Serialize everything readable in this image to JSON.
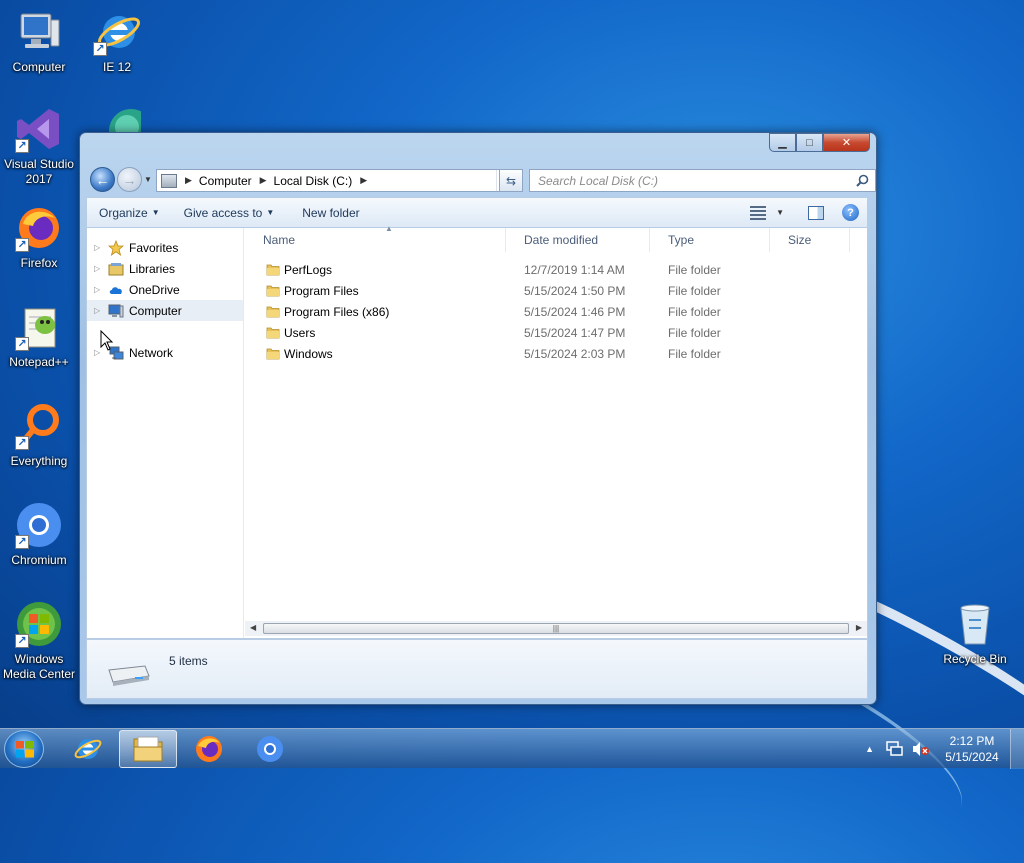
{
  "desktop": {
    "icons": [
      {
        "label": "Computer"
      },
      {
        "label": "IE 12"
      },
      {
        "label": "Visual Studio 2017"
      },
      {
        "label": "Firefox"
      },
      {
        "label": "Notepad++"
      },
      {
        "label": "Everything"
      },
      {
        "label": "Chromium"
      },
      {
        "label": "Windows Media Center"
      },
      {
        "label": "Recycle Bin"
      }
    ]
  },
  "window": {
    "address": {
      "crumbs": [
        "Computer",
        "Local Disk (C:)"
      ]
    },
    "search": {
      "placeholder": "Search Local Disk (C:)"
    },
    "toolbar": {
      "organize": "Organize",
      "give_access": "Give access to",
      "new_folder": "New folder"
    },
    "nav": [
      {
        "label": "Favorites",
        "icon": "star-icon"
      },
      {
        "label": "Libraries",
        "icon": "libraries-icon"
      },
      {
        "label": "OneDrive",
        "icon": "cloud-icon"
      },
      {
        "label": "Computer",
        "icon": "computer-icon"
      },
      {
        "label": "Network",
        "icon": "network-icon"
      }
    ],
    "columns": {
      "name": "Name",
      "date": "Date modified",
      "type": "Type",
      "size": "Size"
    },
    "files": [
      {
        "name": "PerfLogs",
        "date": "12/7/2019 1:14 AM",
        "type": "File folder"
      },
      {
        "name": "Program Files",
        "date": "5/15/2024 1:50 PM",
        "type": "File folder"
      },
      {
        "name": "Program Files (x86)",
        "date": "5/15/2024 1:46 PM",
        "type": "File folder"
      },
      {
        "name": "Users",
        "date": "5/15/2024 1:47 PM",
        "type": "File folder"
      },
      {
        "name": "Windows",
        "date": "5/15/2024 2:03 PM",
        "type": "File folder"
      }
    ],
    "status": {
      "item_count": "5 items"
    }
  },
  "taskbar": {
    "clock_time": "2:12 PM",
    "clock_date": "5/15/2024"
  },
  "colors": {
    "desktop_blue": "#1267c8",
    "window_frame": "#a9c8ea",
    "close_red": "#c74a30",
    "folder_yellow": "#e8c15a"
  }
}
